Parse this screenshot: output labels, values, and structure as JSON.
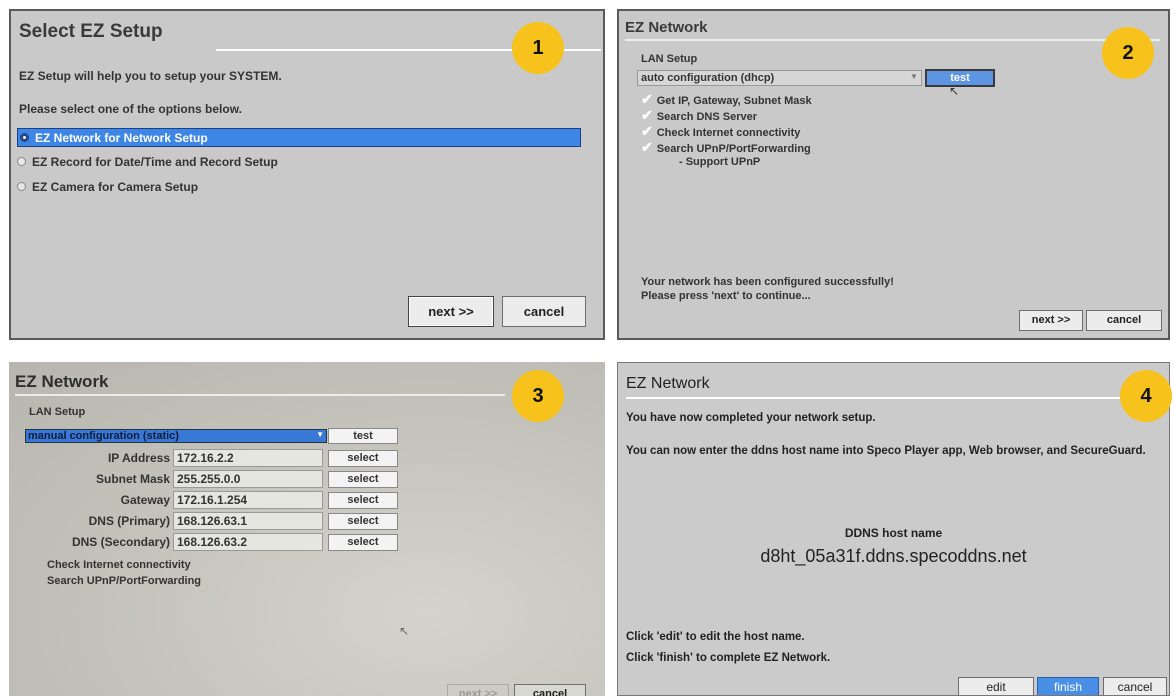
{
  "badges": [
    "1",
    "2",
    "3",
    "4"
  ],
  "panel1": {
    "title": "Select EZ Setup",
    "intro": "EZ Setup will help you to setup your SYSTEM.",
    "prompt": "Please select one of the options below.",
    "options": [
      {
        "label": "EZ Network for Network Setup",
        "selected": true
      },
      {
        "label": "EZ Record for Date/Time and Record Setup",
        "selected": false
      },
      {
        "label": "EZ Camera for Camera Setup",
        "selected": false
      }
    ],
    "next_label": "next >>",
    "cancel_label": "cancel"
  },
  "panel2": {
    "title": "EZ Network",
    "section": "LAN Setup",
    "mode": "auto configuration (dhcp)",
    "test_label": "test",
    "checks": [
      "Get IP, Gateway, Subnet Mask",
      "Search DNS Server",
      "Check Internet connectivity",
      "Search UPnP/PortForwarding"
    ],
    "sub_item": "- Support UPnP",
    "status_line1": "Your network has been configured successfully!",
    "status_line2": "Please press 'next' to continue...",
    "next_label": "next >>",
    "cancel_label": "cancel"
  },
  "panel3": {
    "title": "EZ Network",
    "section": "LAN Setup",
    "mode": "manual configuration (static)",
    "test_label": "test",
    "fields": [
      {
        "label": "IP Address",
        "value": "172.16.2.2",
        "button": "select"
      },
      {
        "label": "Subnet Mask",
        "value": "255.255.0.0",
        "button": "select"
      },
      {
        "label": "Gateway",
        "value": "172.16.1.254",
        "button": "select"
      },
      {
        "label": "DNS (Primary)",
        "value": "168.126.63.1",
        "button": "select"
      },
      {
        "label": "DNS (Secondary)",
        "value": "168.126.63.2",
        "button": "select"
      }
    ],
    "line1": "Check Internet connectivity",
    "line2": "Search UPnP/PortForwarding",
    "next_label": "next >>",
    "cancel_label": "cancel"
  },
  "panel4": {
    "title": "EZ Network",
    "line1": "You have now completed your network setup.",
    "line2": "You can now enter the ddns host name into Speco Player app, Web browser, and SecureGuard.",
    "host_caption": "DDNS host name",
    "host_name": "d8ht_05a31f.ddns.specoddns.net",
    "help1": "Click 'edit' to edit the host name.",
    "help2": "Click 'finish' to complete EZ Network.",
    "edit_label": "edit",
    "finish_label": "finish",
    "cancel_label": "cancel"
  }
}
